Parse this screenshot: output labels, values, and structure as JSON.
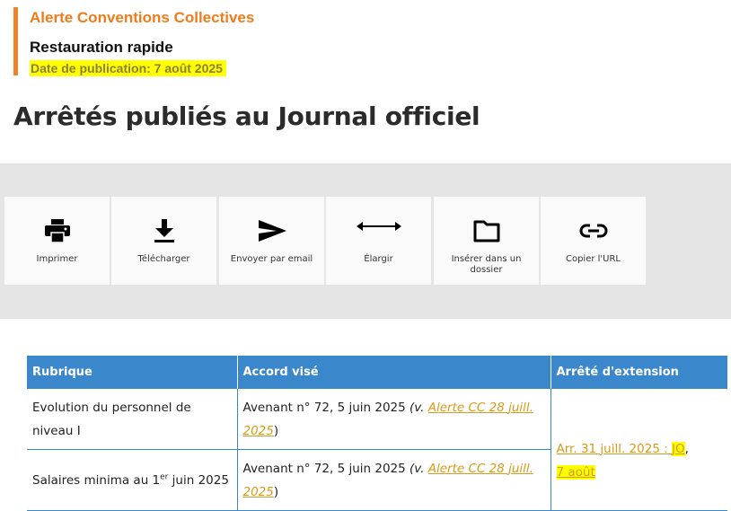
{
  "alert": {
    "title": "Alerte Conventions Collectives",
    "subtitle": "Restauration rapide",
    "pub_date": "Date de publication: 7 août 2025"
  },
  "page_title": "Arrêtés publiés au Journal officiel",
  "toolbar": {
    "print": {
      "label": "Imprimer",
      "icon": "printer-icon"
    },
    "download": {
      "label": "Télécharger",
      "icon": "download-icon"
    },
    "email": {
      "label": "Envoyer par email",
      "icon": "send-icon"
    },
    "expand": {
      "label": "Élargir",
      "icon": "expand-arrows-icon"
    },
    "folder": {
      "label": "Insérer dans un dossier",
      "icon": "folder-icon"
    },
    "copy_url": {
      "label": "Copier l'URL",
      "icon": "link-icon"
    }
  },
  "table": {
    "headers": [
      "Rubrique",
      "Accord visé",
      "Arrêté d'extension"
    ],
    "rows": [
      {
        "rubrique": "Evolution du personnel de niveau I",
        "accord_text": "Avenant n° 72, 5 juin 2025 ",
        "accord_ref_open": "(v. ",
        "accord_link": "Alerte CC 28 juill. 2025",
        "accord_ref_close": ")"
      },
      {
        "rubrique_pre": "Salaires minima au 1",
        "rubrique_sup": "er",
        "rubrique_post": " juin 2025",
        "accord_text": "Avenant n° 72, 5 juin 2025 ",
        "accord_ref_open": "(v. ",
        "accord_link": "Alerte CC 28 juill. 2025",
        "accord_ref_close": ")"
      }
    ],
    "extension": {
      "arr_link": "Arr. 31 juill. 2025 : ",
      "jo_link": "JO",
      "sep": ",",
      "date_link": "7 août"
    }
  },
  "colors": {
    "accent_orange": "#ef7c1a",
    "header_blue": "#3a87cc",
    "link_gold": "#d99a1a",
    "highlight": "#ffff00"
  }
}
